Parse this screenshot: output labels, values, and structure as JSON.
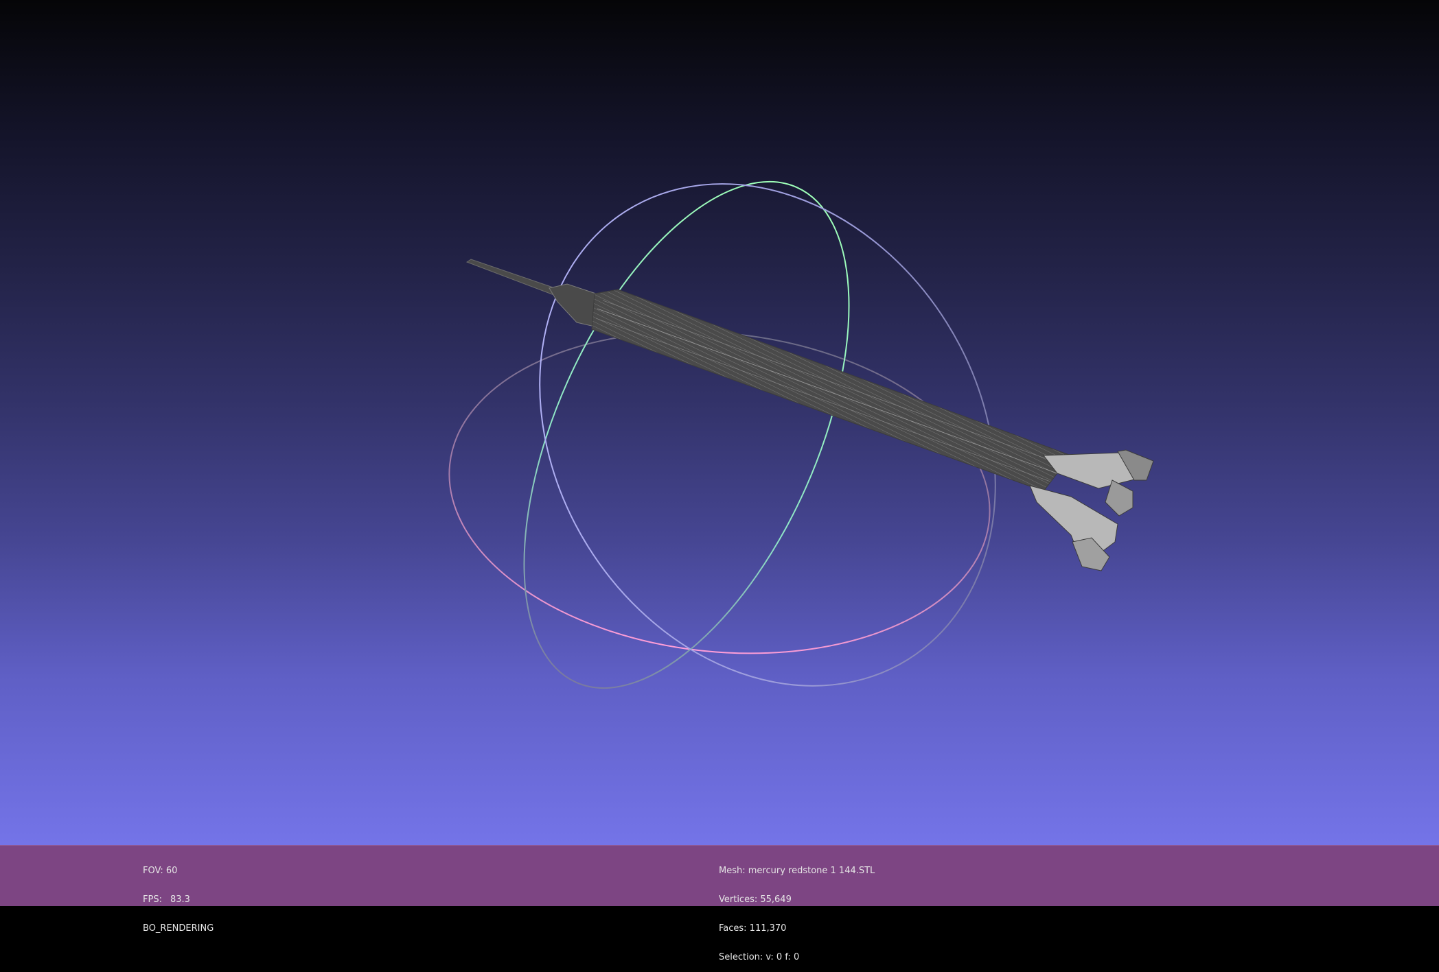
{
  "viewport": {
    "background_top": "#050507",
    "background_bottom": "#7474e8",
    "trackball": {
      "x_ring_color": "#ff9ed8",
      "y_ring_color": "#9effb8",
      "z_ring_color": "#b3b3ff"
    },
    "mesh_color": "#4a4a4a"
  },
  "info_bar": {
    "background": "#7d4583",
    "left": {
      "fov": "FOV: 60",
      "fps_label": "FPS:",
      "fps_value": "83.3",
      "render_mode": "BO_RENDERING"
    },
    "center": {
      "mesh": "Mesh: mercury redstone 1 144.STL",
      "vertices": "Vertices: 55,649",
      "faces": "Faces: 111,370",
      "selection": "Selection: v: 0 f: 0"
    }
  }
}
